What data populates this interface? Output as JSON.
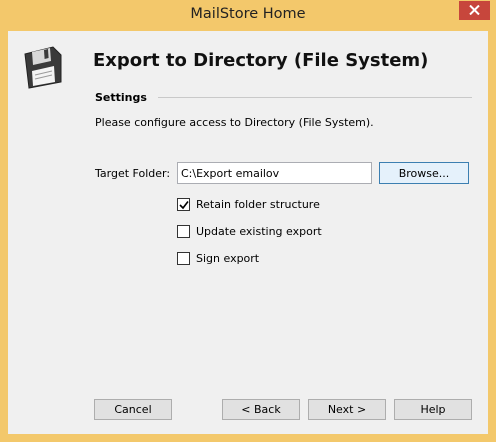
{
  "window": {
    "title": "MailStore Home",
    "close_icon": "close-icon",
    "frame_color": "#f3c86b",
    "close_color": "#c7463c"
  },
  "header": {
    "icon": "floppy-disk-icon",
    "title": "Export to Directory (File System)"
  },
  "settings": {
    "section_label": "Settings",
    "instructions": "Please configure access to Directory (File System).",
    "target_folder_label": "Target Folder:",
    "target_folder_value": "C:\\Export emailov",
    "browse_label": "Browse...",
    "options": [
      {
        "label": "Retain folder structure",
        "checked": true
      },
      {
        "label": "Update existing export",
        "checked": false
      },
      {
        "label": "Sign export",
        "checked": false
      }
    ]
  },
  "footer": {
    "cancel_label": "Cancel",
    "back_label": "< Back",
    "next_label": "Next >",
    "help_label": "Help"
  }
}
